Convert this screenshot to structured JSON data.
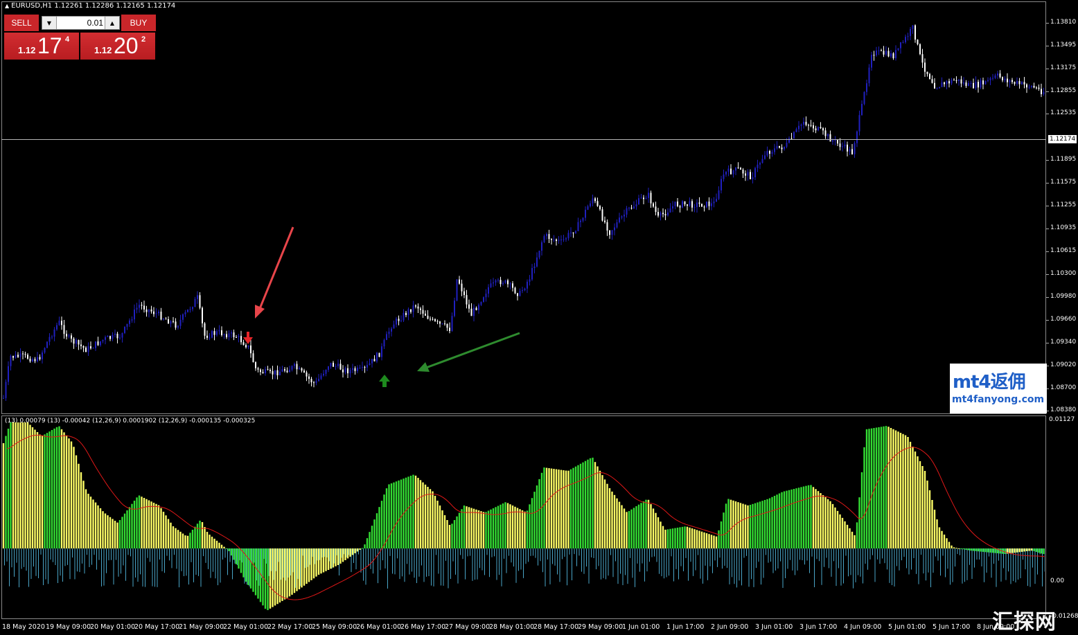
{
  "chart": {
    "symbol_line": "EURUSD,H1  1.12261 1.12286 1.12165 1.12174",
    "current_price": "1.12174"
  },
  "trade_panel": {
    "sell_label": "SELL",
    "buy_label": "BUY",
    "lot_value": "0.01",
    "sell_price": {
      "prefix": "1.12",
      "big": "17",
      "sup": "4"
    },
    "buy_price": {
      "prefix": "1.12",
      "big": "20",
      "sup": "2"
    }
  },
  "price_axis": [
    "1.13810",
    "1.13495",
    "1.13175",
    "1.12855",
    "1.12535",
    "1.11895",
    "1.11575",
    "1.11255",
    "1.10935",
    "1.10615",
    "1.10300",
    "1.09980",
    "1.09660",
    "1.09340",
    "1.09020",
    "1.08700",
    "1.08380"
  ],
  "indicator": {
    "header": "(13) 0.00079  (13) -0.00042  (12,26,9) 0.0001902  (12,26,9) -0.000135 -0.000325",
    "axis_top": "0.01127",
    "axis_mid": "0.00",
    "axis_bottom": "-0.01268"
  },
  "time_axis": [
    "18 May 2020",
    "19 May 09:00",
    "20 May 01:00",
    "20 May 17:00",
    "21 May 09:00",
    "22 May 01:00",
    "22 May 17:00",
    "25 May 09:00",
    "26 May 01:00",
    "26 May 17:00",
    "27 May 09:00",
    "28 May 01:00",
    "28 May 17:00",
    "29 May 09:00",
    "1 Jun 01:00",
    "1 Jun 17:00",
    "2 Jun 09:00",
    "3 Jun 01:00",
    "3 Jun 17:00",
    "4 Jun 09:00",
    "5 Jun 01:00",
    "5 Jun 17:00",
    "8 Jun 09:00"
  ],
  "annotations": {
    "sell_arrow_color": "#e8262a",
    "buy_arrow_color": "#1e8a1e",
    "pointer_red": "#e8454a",
    "pointer_green": "#2e8b2e"
  },
  "colors": {
    "bull_candle": "#2020c0",
    "bear_candle": "#ffffff",
    "hist_green": "#33dd33",
    "hist_yellow": "#ffff66",
    "hist_blue": "#4aa6c8",
    "signal_red": "#e01818"
  },
  "watermark": {
    "logo": "mt4返佣",
    "url": "mt4fanyong.com",
    "bottom": "汇探网"
  }
}
